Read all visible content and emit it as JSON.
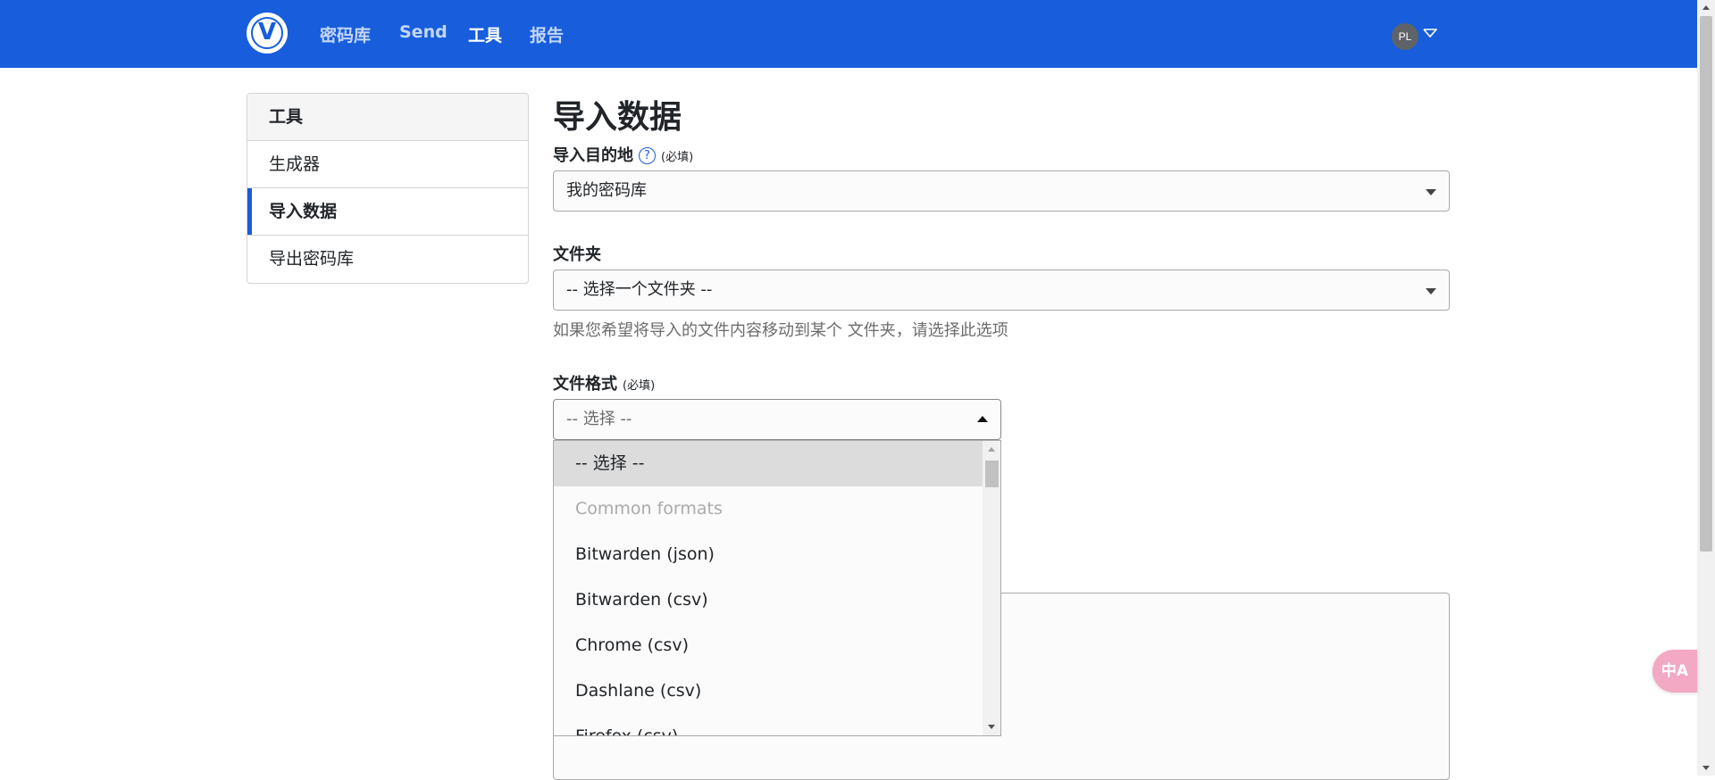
{
  "nav": {
    "items": [
      "密码库",
      "Send",
      "工具",
      "报告"
    ],
    "active_index": 2,
    "avatar_initials": "PL"
  },
  "sidebar": {
    "header": "工具",
    "items": [
      "生成器",
      "导入数据",
      "导出密码库"
    ],
    "active_index": 1
  },
  "page": {
    "title": "导入数据",
    "destination_label": "导入目的地",
    "destination_help": "?",
    "required_text": "(必填)",
    "destination_value": "我的密码库",
    "folder_label": "文件夹",
    "folder_value": "-- 选择一个文件夹 --",
    "folder_hint": "如果您希望将导入的文件内容移动到某个 文件夹，请选择此选项",
    "format_label": "文件格式",
    "format_value": "-- 选择 --"
  },
  "format_dropdown": {
    "options": [
      "-- 选择 --",
      "Common formats",
      "Bitwarden (json)",
      "Bitwarden (csv)",
      "Chrome (csv)",
      "Dashlane (csv)",
      "Firefox (csv)"
    ],
    "selected_index": 0,
    "group_index": 1
  },
  "translate_button_glyph": "中A"
}
